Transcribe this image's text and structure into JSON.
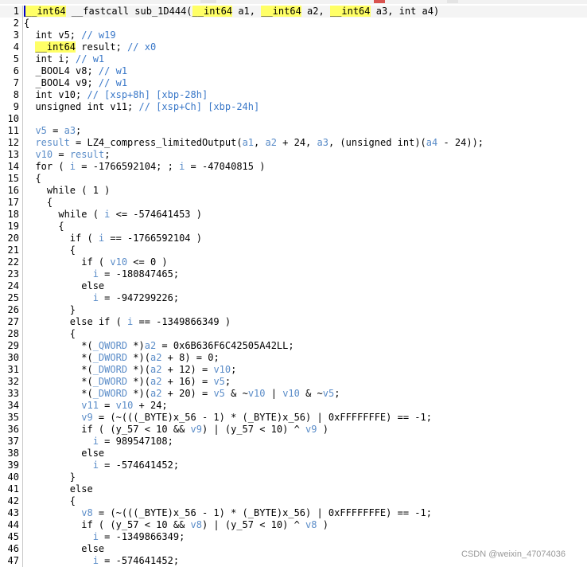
{
  "lines": [
    {
      "n": "1",
      "html": "<span class=\"hl hlbar\">__int64</span> __fastcall sub_1D444(<span class=\"hl\">__int64</span> a1, <span class=\"hl\">__int64</span> a2, <span class=\"hl\">__int64</span> a3, int a4)"
    },
    {
      "n": "2",
      "html": "{"
    },
    {
      "n": "3",
      "html": "  int v5; <span class=\"cmt\">// w19</span>"
    },
    {
      "n": "4",
      "html": "  <span class=\"hl\">__int64</span> result; <span class=\"cmt\">// x0</span>"
    },
    {
      "n": "5",
      "html": "  int i; <span class=\"cmt\">// w1</span>"
    },
    {
      "n": "6",
      "html": "  _BOOL4 v8; <span class=\"cmt\">// w1</span>"
    },
    {
      "n": "7",
      "html": "  _BOOL4 v9; <span class=\"cmt\">// w1</span>"
    },
    {
      "n": "8",
      "html": "  int v10; <span class=\"cmt\">// [xsp+8h] [xbp-28h]</span>"
    },
    {
      "n": "9",
      "html": "  unsigned int v11; <span class=\"cmt\">// [xsp+Ch] [xbp-24h]</span>"
    },
    {
      "n": "10",
      "html": ""
    },
    {
      "n": "11",
      "html": "  <span class=\"var\">v5</span> = <span class=\"var\">a3</span>;"
    },
    {
      "n": "12",
      "html": "  <span class=\"var\">result</span> = LZ4_compress_limitedOutput(<span class=\"var\">a1</span>, <span class=\"var\">a2</span> + 24, <span class=\"var\">a3</span>, (unsigned int)(<span class=\"var\">a4</span> - 24));"
    },
    {
      "n": "13",
      "html": "  <span class=\"var\">v10</span> = <span class=\"var\">result</span>;"
    },
    {
      "n": "14",
      "html": "  for ( <span class=\"var\">i</span> = -1766592104; ; <span class=\"var\">i</span> = -47040815 )"
    },
    {
      "n": "15",
      "html": "  {"
    },
    {
      "n": "16",
      "html": "    while ( 1 )"
    },
    {
      "n": "17",
      "html": "    {"
    },
    {
      "n": "18",
      "html": "      while ( <span class=\"var\">i</span> <= -574641453 )"
    },
    {
      "n": "19",
      "html": "      {"
    },
    {
      "n": "20",
      "html": "        if ( <span class=\"var\">i</span> == -1766592104 )"
    },
    {
      "n": "21",
      "html": "        {"
    },
    {
      "n": "22",
      "html": "          if ( <span class=\"var\">v10</span> <= 0 )"
    },
    {
      "n": "23",
      "html": "            <span class=\"var\">i</span> = -180847465;"
    },
    {
      "n": "24",
      "html": "          else"
    },
    {
      "n": "25",
      "html": "            <span class=\"var\">i</span> = -947299226;"
    },
    {
      "n": "26",
      "html": "        }"
    },
    {
      "n": "27",
      "html": "        else if ( <span class=\"var\">i</span> == -1349866349 )"
    },
    {
      "n": "28",
      "html": "        {"
    },
    {
      "n": "29",
      "html": "          *(<span class=\"var\">_QWORD</span> *)<span class=\"var\">a2</span> = 0x6B636F6C42505A42LL;"
    },
    {
      "n": "30",
      "html": "          *(<span class=\"var\">_DWORD</span> *)(<span class=\"var\">a2</span> + 8) = 0;"
    },
    {
      "n": "31",
      "html": "          *(<span class=\"var\">_DWORD</span> *)(<span class=\"var\">a2</span> + 12) = <span class=\"var\">v10</span>;"
    },
    {
      "n": "32",
      "html": "          *(<span class=\"var\">_DWORD</span> *)(<span class=\"var\">a2</span> + 16) = <span class=\"var\">v5</span>;"
    },
    {
      "n": "33",
      "html": "          *(<span class=\"var\">_DWORD</span> *)(<span class=\"var\">a2</span> + 20) = <span class=\"var\">v5</span> & ~<span class=\"var\">v10</span> | <span class=\"var\">v10</span> & ~<span class=\"var\">v5</span>;"
    },
    {
      "n": "34",
      "html": "          <span class=\"var\">v11</span> = <span class=\"var\">v10</span> + 24;"
    },
    {
      "n": "35",
      "html": "          <span class=\"var\">v9</span> = (~(((_BYTE)x_56 - 1) * (_BYTE)x_56) | 0xFFFFFFFE) == -1;"
    },
    {
      "n": "36",
      "html": "          if ( (y_57 < 10 && <span class=\"var\">v9</span>) | (y_57 < 10) ^ <span class=\"var\">v9</span> )"
    },
    {
      "n": "37",
      "html": "            <span class=\"var\">i</span> = 989547108;"
    },
    {
      "n": "38",
      "html": "          else"
    },
    {
      "n": "39",
      "html": "            <span class=\"var\">i</span> = -574641452;"
    },
    {
      "n": "40",
      "html": "        }"
    },
    {
      "n": "41",
      "html": "        else"
    },
    {
      "n": "42",
      "html": "        {"
    },
    {
      "n": "43",
      "html": "          <span class=\"var\">v8</span> = (~(((_BYTE)x_56 - 1) * (_BYTE)x_56) | 0xFFFFFFFE) == -1;"
    },
    {
      "n": "44",
      "html": "          if ( (y_57 < 10 && <span class=\"var\">v8</span>) | (y_57 < 10) ^ <span class=\"var\">v8</span> )"
    },
    {
      "n": "45",
      "html": "            <span class=\"var\">i</span> = -1349866349;"
    },
    {
      "n": "46",
      "html": "          else"
    },
    {
      "n": "47",
      "html": "            <span class=\"var\">i</span> = -574641452;"
    }
  ],
  "watermark": "CSDN @weixin_47074036"
}
